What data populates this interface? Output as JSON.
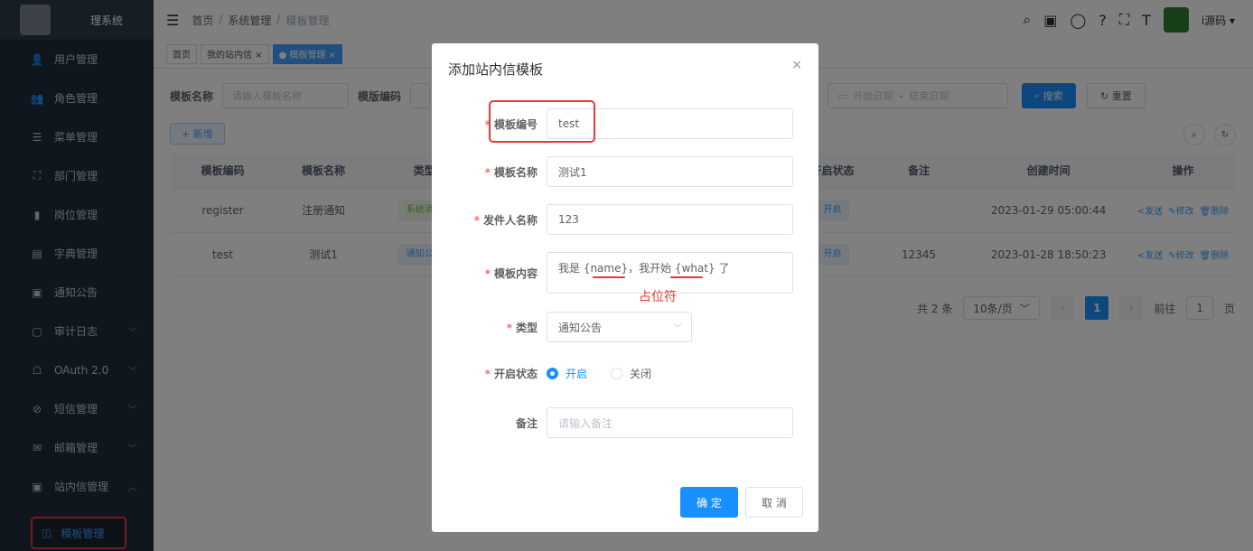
{
  "sidebar": {
    "title": "理系统",
    "items": [
      {
        "label": "用户管理",
        "icon": "user-icon",
        "glyph": "👤"
      },
      {
        "label": "角色管理",
        "icon": "role-icon",
        "glyph": "👥"
      },
      {
        "label": "菜单管理",
        "icon": "menu-icon",
        "glyph": "☰"
      },
      {
        "label": "部门管理",
        "icon": "dept-icon",
        "glyph": "⛶"
      },
      {
        "label": "岗位管理",
        "icon": "post-icon",
        "glyph": "▮"
      },
      {
        "label": "字典管理",
        "icon": "dict-icon",
        "glyph": "▤"
      },
      {
        "label": "通知公告",
        "icon": "notice-icon",
        "glyph": "▣"
      },
      {
        "label": "审计日志",
        "icon": "log-icon",
        "glyph": "▢",
        "caret": "﹀"
      },
      {
        "label": "OAuth 2.0",
        "icon": "oauth-icon",
        "glyph": "☖",
        "caret": "﹀"
      },
      {
        "label": "短信管理",
        "icon": "sms-icon",
        "glyph": "⊘",
        "caret": "﹀"
      },
      {
        "label": "邮箱管理",
        "icon": "mail-icon",
        "glyph": "✉",
        "caret": "﹀"
      },
      {
        "label": "站内信管理",
        "icon": "message-icon",
        "glyph": "▣",
        "caret": "︿"
      }
    ],
    "sub_item": {
      "label": "模板管理",
      "icon": "book-icon",
      "glyph": "◫"
    }
  },
  "navbar": {
    "breadcrumb": [
      "首页",
      "/",
      "系统管理",
      "/",
      "模板管理"
    ],
    "user": "i源码"
  },
  "tags": [
    {
      "label": "首页"
    },
    {
      "label": "我的站内信 ×"
    },
    {
      "label": "● 模板管理 ×",
      "active": true
    }
  ],
  "search": {
    "name_label": "模板名称",
    "name_placeholder": "请输入模板名称",
    "code_label": "模版编码",
    "date_start": "开始日期",
    "date_sep": "-",
    "date_end": "结束日期",
    "search_btn": "搜索",
    "reset_btn": "重置",
    "add_btn": "+ 新增"
  },
  "table": {
    "headers": [
      "模板编码",
      "模板名称",
      "类型",
      "",
      "",
      "",
      "",
      "开启状态",
      "备注",
      "创建时间",
      "操作"
    ],
    "rows": [
      {
        "code": "register",
        "name": "注册通知",
        "type": "系统消息",
        "type_color": "green",
        "status": "开启",
        "remark": "",
        "created": "2023-01-29 05:00:44"
      },
      {
        "code": "test",
        "name": "测试1",
        "type": "通知公告",
        "type_color": "blue",
        "status": "开启",
        "remark": "12345",
        "created": "2023-01-28 18:50:23"
      }
    ],
    "ops": [
      "<发送",
      "✎修改",
      "🗑删除"
    ]
  },
  "pager": {
    "total": "共 2 条",
    "size": "10条/页",
    "page": "1",
    "goto_label": "前往",
    "goto_value": "1",
    "goto_suffix": "页"
  },
  "dialog": {
    "title": "添加站内信模板",
    "close": "×",
    "fields": {
      "code": {
        "label": "模板编号",
        "value": "test"
      },
      "name": {
        "label": "模板名称",
        "value": "测试1"
      },
      "nickname": {
        "label": "发件人名称",
        "value": "123"
      },
      "content": {
        "label": "模板内容",
        "value": "我是 {name}，我开始 {what} 了"
      },
      "type": {
        "label": "类型",
        "value": "通知公告"
      },
      "status": {
        "label": "开启状态",
        "on": "开启",
        "off": "关闭"
      },
      "remark": {
        "label": "备注",
        "placeholder": "请输入备注"
      }
    },
    "ok": "确 定",
    "cancel": "取 消"
  },
  "annotation": "占位符",
  "colors": {
    "primary": "#1890ff",
    "sidebar": "#1f2d3d",
    "highlight": "#e53935"
  }
}
